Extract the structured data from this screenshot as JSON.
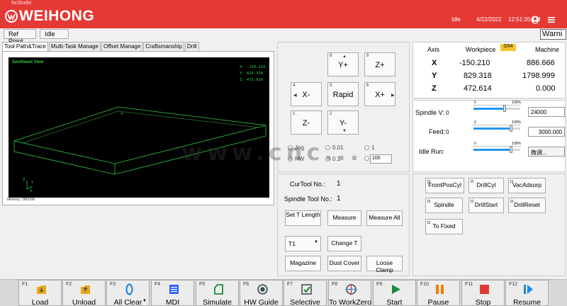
{
  "window": {
    "app_title": "NcStudio",
    "logo": "WEIHONG"
  },
  "header": {
    "status": "Idle",
    "date": "4/22/2022",
    "time": "12:51:20 PM",
    "icons": [
      "user-icon",
      "menu-icon"
    ],
    "bar_color": "#e53935"
  },
  "toolbar": {
    "ref_point": "Ref Point",
    "idle": "Idle",
    "warning": "Warni"
  },
  "tabs": [
    "Tool Path&Trace",
    "Multi-Task Manage",
    "Offset Manage",
    "Craftsmanship",
    "Drill"
  ],
  "viewport": {
    "view_name": "Southeast View",
    "x": "X:   -150.210",
    "y": "Y:    829.318",
    "z": "Z:    472.610",
    "memory": "Memory: 2M/16M"
  },
  "jog": {
    "buttons": [
      {
        "num": "8",
        "label": "Y+"
      },
      {
        "num": "9",
        "label": "Z+"
      },
      {
        "num": "4",
        "label": "X-"
      },
      {
        "num": "5",
        "label": "Rapid"
      },
      {
        "num": "6",
        "label": "X+"
      },
      {
        "num": "1",
        "label": "Z-"
      },
      {
        "num": "2",
        "label": "Y-"
      }
    ],
    "modes": [
      "Jog",
      "HW"
    ],
    "steps": [
      "0.01",
      "1",
      "0.1"
    ],
    "step_value": "100"
  },
  "axes": {
    "headers": {
      "axis": "Axis",
      "workpiece": "Workpiece",
      "machine": "Machine",
      "wcs": "G54"
    },
    "rows": [
      {
        "axis": "X",
        "workpiece": "-150.210",
        "machine": "886.666"
      },
      {
        "axis": "Y",
        "workpiece": "829.318",
        "machine": "1798.999"
      },
      {
        "axis": "Z",
        "workpiece": "472.614",
        "machine": "0.000"
      }
    ]
  },
  "spindle": {
    "spindle_v_label": "Spindle V:",
    "spindle_v_pct": "0",
    "spindle_v_value": "24000",
    "feed_label": "Feed:",
    "feed_pct": "0",
    "feed_value": "3000.000",
    "idle_run_label": "Idle Run:",
    "idle_run_value": "微调...",
    "slider_min": "0",
    "slider_max": "100%",
    "levels": [
      0.66,
      0.8,
      0.8
    ]
  },
  "tool": {
    "cur_tool_label": "CurTool No.:",
    "cur_tool_value": "1",
    "spindle_tool_label": "Spindle Tool No.:",
    "spindle_tool_value": "1",
    "buttons": {
      "set_t_length": "Set T Length",
      "measure": "Measure",
      "measure_all": "Measure All",
      "change_t": "Change T",
      "magazine": "Magazine",
      "dust_cover": "Dust Cover",
      "loose_clamp": "Loose Clamp"
    },
    "tool_select": "T1"
  },
  "io_buttons": [
    "FrontPosCyl",
    "DrillCyl",
    "VacAdsorp",
    "Spindle",
    "DrillStart",
    "DrillReset",
    "To Fixed"
  ],
  "fkeys": [
    {
      "key": "F1",
      "label": "Load",
      "icon": "load-icon"
    },
    {
      "key": "F2",
      "label": "Unload",
      "icon": "unload-icon"
    },
    {
      "key": "F3",
      "label": "All Clear",
      "icon": "clear-icon"
    },
    {
      "key": "F4",
      "label": "MDI",
      "icon": "mdi-icon"
    },
    {
      "key": "F5",
      "label": "Simulate",
      "icon": "simulate-icon"
    },
    {
      "key": "F6",
      "label": "HW Guide",
      "icon": "hw-guide-icon"
    },
    {
      "key": "F7",
      "label": "Selective",
      "icon": "selective-icon"
    },
    {
      "key": "F8",
      "label": "To WorkZero",
      "icon": "workzero-icon"
    },
    {
      "key": "F9",
      "label": "Start",
      "icon": "start-icon"
    },
    {
      "key": "F10",
      "label": "Pause",
      "icon": "pause-icon"
    },
    {
      "key": "F11",
      "label": "Stop",
      "icon": "stop-icon"
    },
    {
      "key": "F12",
      "label": "Resume",
      "icon": "resume-icon"
    }
  ],
  "watermark": "www.cnc..."
}
